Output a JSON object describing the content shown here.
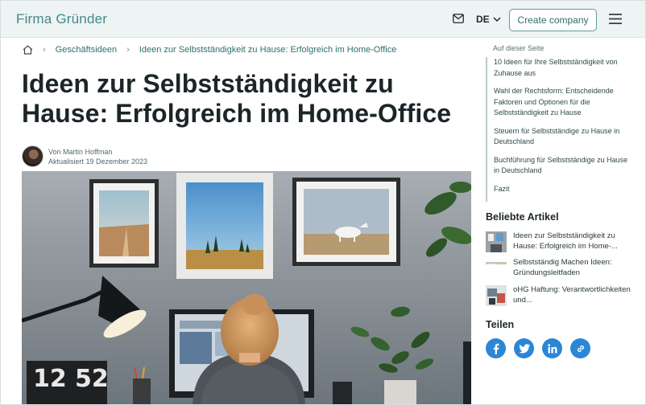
{
  "header": {
    "brand": "Firma Gründer",
    "language": "DE",
    "create_label": "Create company"
  },
  "breadcrumb": {
    "items": [
      "Geschäftsideen",
      "Ideen zur Selbstständigkeit zu Hause: Erfolgreich im Home-Office"
    ]
  },
  "article": {
    "title": "Ideen zur Selbstständigkeit zu Hause: Erfolgreich im Home-Office",
    "author_line": "Von Martin Hoffman",
    "updated_line": "Aktualisiert 19 Dezember 2023",
    "clock_hours": "12",
    "clock_minutes": "52"
  },
  "toc": {
    "label": "Auf dieser Seite",
    "items": [
      "10 Ideen für Ihre Selbstständigkeit von Zuhause aus",
      "Wahl der Rechtsform: Entscheidende Faktoren und Optionen für die Selbstständigkeit zu Hause",
      "Steuern für Selbstständige zu Hause in Deutschland",
      "Buchführung für Selbstständige zu Hause in Deutschland",
      "Fazit"
    ]
  },
  "popular": {
    "heading": "Beliebte Artikel",
    "items": [
      "Ideen zur Selbstständigkeit zu Hause: Erfolgreich im Home-...",
      "Selbstständig Machen Ideen: Gründungsleitfaden",
      "oHG Haftung: Verantwortlichkeiten und..."
    ]
  },
  "share": {
    "heading": "Teilen",
    "networks": [
      "facebook-icon",
      "twitter-icon",
      "linkedin-icon",
      "link-icon"
    ]
  },
  "colors": {
    "brand": "#3f8a86",
    "share_blue": "#2b86d6",
    "header_bg": "#eef3f4"
  }
}
